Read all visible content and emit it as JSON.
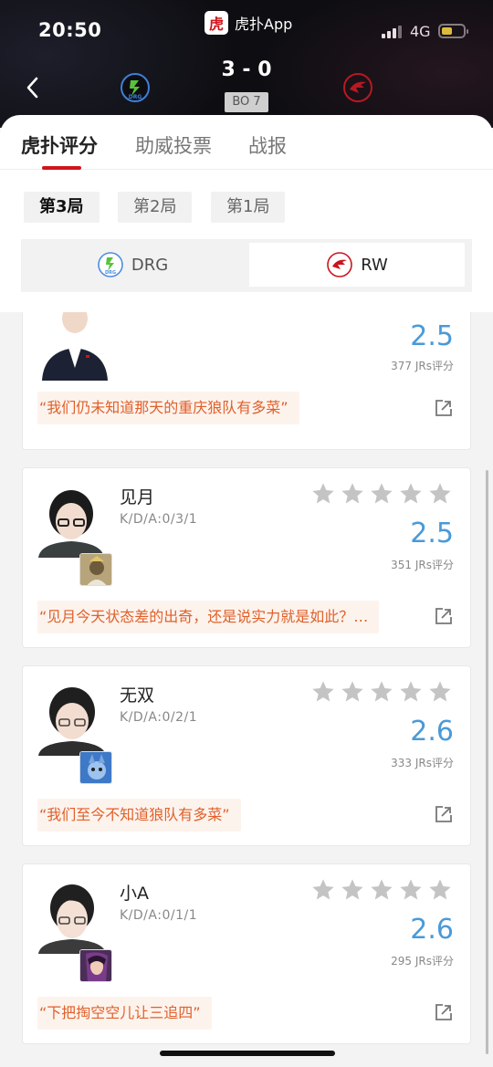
{
  "status": {
    "time": "20:50",
    "network": "4G"
  },
  "app": {
    "name": "虎扑App",
    "logo_char": "虎"
  },
  "match": {
    "score": "3 - 0",
    "format": "BO 7",
    "team_left": "DRG",
    "team_right": "RW"
  },
  "tabs": [
    {
      "label": "虎扑评分"
    },
    {
      "label": "助威投票"
    },
    {
      "label": "战报"
    }
  ],
  "game_tabs": [
    {
      "label": "第3局"
    },
    {
      "label": "第2局"
    },
    {
      "label": "第1局"
    }
  ],
  "team_switch": {
    "left": "DRG",
    "right": "RW"
  },
  "players": [
    {
      "name": "",
      "kda": "",
      "rating": "2.5",
      "votes": "377 JRs评分",
      "quote": "“我们仍未知道那天的重庆狼队有多菜”"
    },
    {
      "name": "见月",
      "kda": "K/D/A:0/3/1",
      "rating": "2.5",
      "votes": "351 JRs评分",
      "quote": "“见月今天状态差的出奇，还是说实力就是如此？…"
    },
    {
      "name": "无双",
      "kda": "K/D/A:0/2/1",
      "rating": "2.6",
      "votes": "333 JRs评分",
      "quote": "“我们至今不知道狼队有多菜”"
    },
    {
      "name": "小A",
      "kda": "K/D/A:0/1/1",
      "rating": "2.6",
      "votes": "295 JRs评分",
      "quote": "“下把掏空空儿让三追四”"
    }
  ],
  "colors": {
    "accent_red": "#d0141b",
    "rating_blue": "#4a9ad8",
    "quote_orange": "#e0602a",
    "quote_bg": "#fdf3ed",
    "star_gray": "#c4c4c4"
  },
  "icons": {
    "back": "chevron-left-icon",
    "star": "star-icon",
    "share": "share-external-icon",
    "team_left_logo": "drg-logo",
    "team_right_logo": "rw-logo"
  }
}
